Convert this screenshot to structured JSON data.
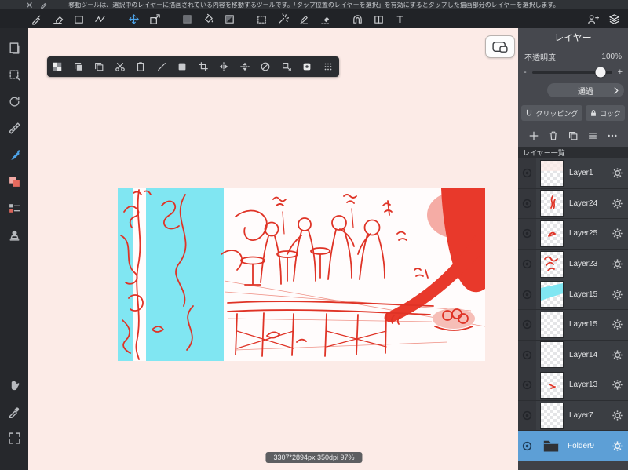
{
  "message_bar": {
    "text": "移動ツールは、選択中のレイヤーに描画されている内容を移動するツールです。「タップ位置のレイヤーを選択」を有効にするとタップした描画部分のレイヤーを選択します。"
  },
  "toolbar": {
    "text_tool_label": "T"
  },
  "layers_panel": {
    "title": "レイヤー",
    "opacity": {
      "label": "不透明度",
      "value": "100%",
      "minus": "-",
      "plus": "+",
      "percent": 100
    },
    "blend_mode_button": "通過",
    "clipping_button": "クリッピング",
    "lock_button": "ロック",
    "list_header": "レイヤー一覧",
    "layers": [
      {
        "name": "Layer1",
        "visible": true
      },
      {
        "name": "Layer24",
        "visible": true
      },
      {
        "name": "Layer25",
        "visible": true
      },
      {
        "name": "Layer23",
        "visible": true
      },
      {
        "name": "Layer15",
        "visible": true
      },
      {
        "name": "Layer15",
        "visible": true
      },
      {
        "name": "Layer14",
        "visible": true
      },
      {
        "name": "Layer13",
        "visible": true
      },
      {
        "name": "Layer7",
        "visible": true
      },
      {
        "name": "Folder9",
        "visible": true,
        "selected": true,
        "type": "folder"
      }
    ]
  },
  "canvas": {
    "status_text": "3307*2894px 350dpi 97%"
  },
  "colors": {
    "accent_blue": "#4da3e8",
    "selected_row": "#5d9fd6",
    "sketch_red": "#df3326",
    "sketch_cyan": "#80e6f2",
    "canvas_pink": "#fcebe7"
  }
}
